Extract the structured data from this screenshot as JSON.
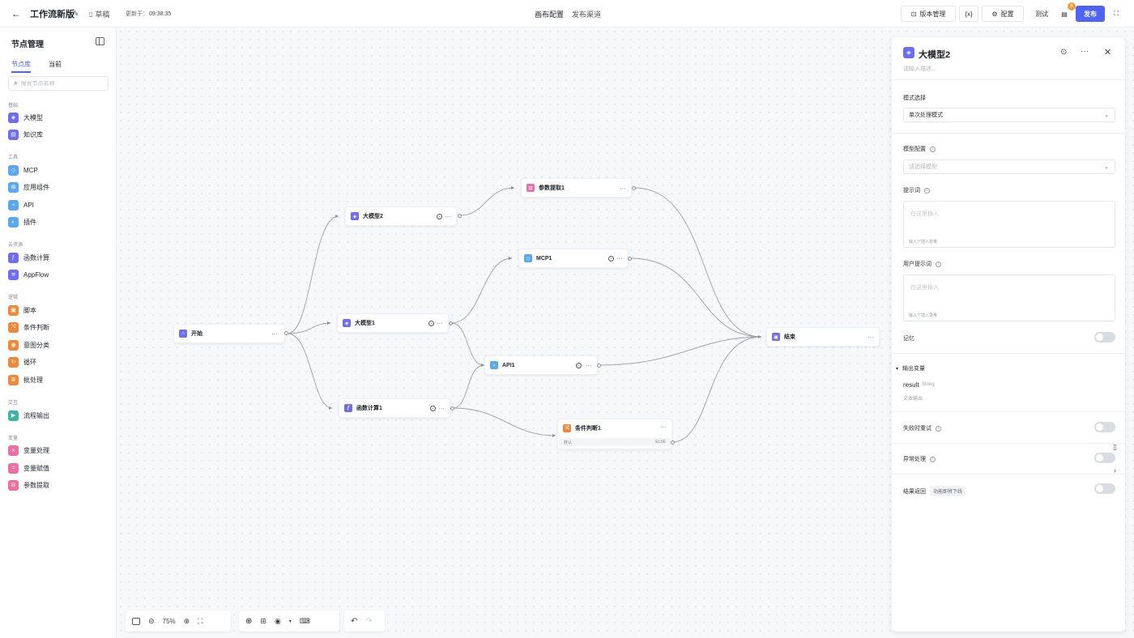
{
  "topbar": {
    "title": "工作流新版",
    "draft": "草稿",
    "updated_label": "更新于：",
    "updated_time": "09:38:35",
    "center_tabs": [
      "画布配置",
      "发布渠道"
    ],
    "version_btn": "版本管理",
    "var_btn": "{x}",
    "config_btn": "配置",
    "test_btn": "测试",
    "badge": "6",
    "publish_btn": "发布"
  },
  "sidebar": {
    "title": "节点管理",
    "tabs": [
      "节点库",
      "当前"
    ],
    "search_placeholder": "搜索节点名称",
    "categories": [
      {
        "name": "基础",
        "items": [
          "大模型",
          "知识库"
        ]
      },
      {
        "name": "工具",
        "items": [
          "MCP",
          "应用组件",
          "API",
          "插件"
        ]
      },
      {
        "name": "云资源",
        "items": [
          "函数计算",
          "AppFlow"
        ]
      },
      {
        "name": "逻辑",
        "items": [
          "脚本",
          "条件判断",
          "意图分类",
          "循环",
          "批处理"
        ]
      },
      {
        "name": "交互",
        "items": [
          "流程输出"
        ]
      },
      {
        "name": "变量",
        "items": [
          "变量处理",
          "变量赋值",
          "参数提取"
        ]
      }
    ]
  },
  "nodes": {
    "start": "开始",
    "llm2": "大模型2",
    "param1": "参数提取1",
    "mcp1": "MCP1",
    "llm1": "大模型1",
    "api1": "API1",
    "func1": "函数计算1",
    "cond1": "条件判断1",
    "cond_default": "默认",
    "cond_else": "ELSE",
    "end": "结束"
  },
  "toolbar": {
    "zoom": "75%"
  },
  "panel": {
    "title": "大模型2",
    "desc_placeholder": "请输入描述...",
    "mode_label": "模式选择",
    "mode_value": "单次处理模式",
    "model_label": "模型配置",
    "model_placeholder": "请选择模型",
    "prompt_label": "提示词",
    "prompt_placeholder": "在这里输入",
    "prompt_hint": "输入\"/\"插入变量",
    "user_prompt_label": "用户提示词",
    "user_prompt_placeholder": "在这里输入",
    "user_prompt_hint": "输入\"/\"插入变量",
    "memory_label": "记忆",
    "output_label": "输出变量",
    "output_name": "result",
    "output_type": "String",
    "output_desc": "文本输出",
    "retry_label": "失败时重试",
    "error_label": "异常处理",
    "return_label": "结果返回",
    "return_tag": "功能即将下线"
  },
  "colors": {
    "accent": "#4f63f5",
    "badge": "#f29a38"
  }
}
